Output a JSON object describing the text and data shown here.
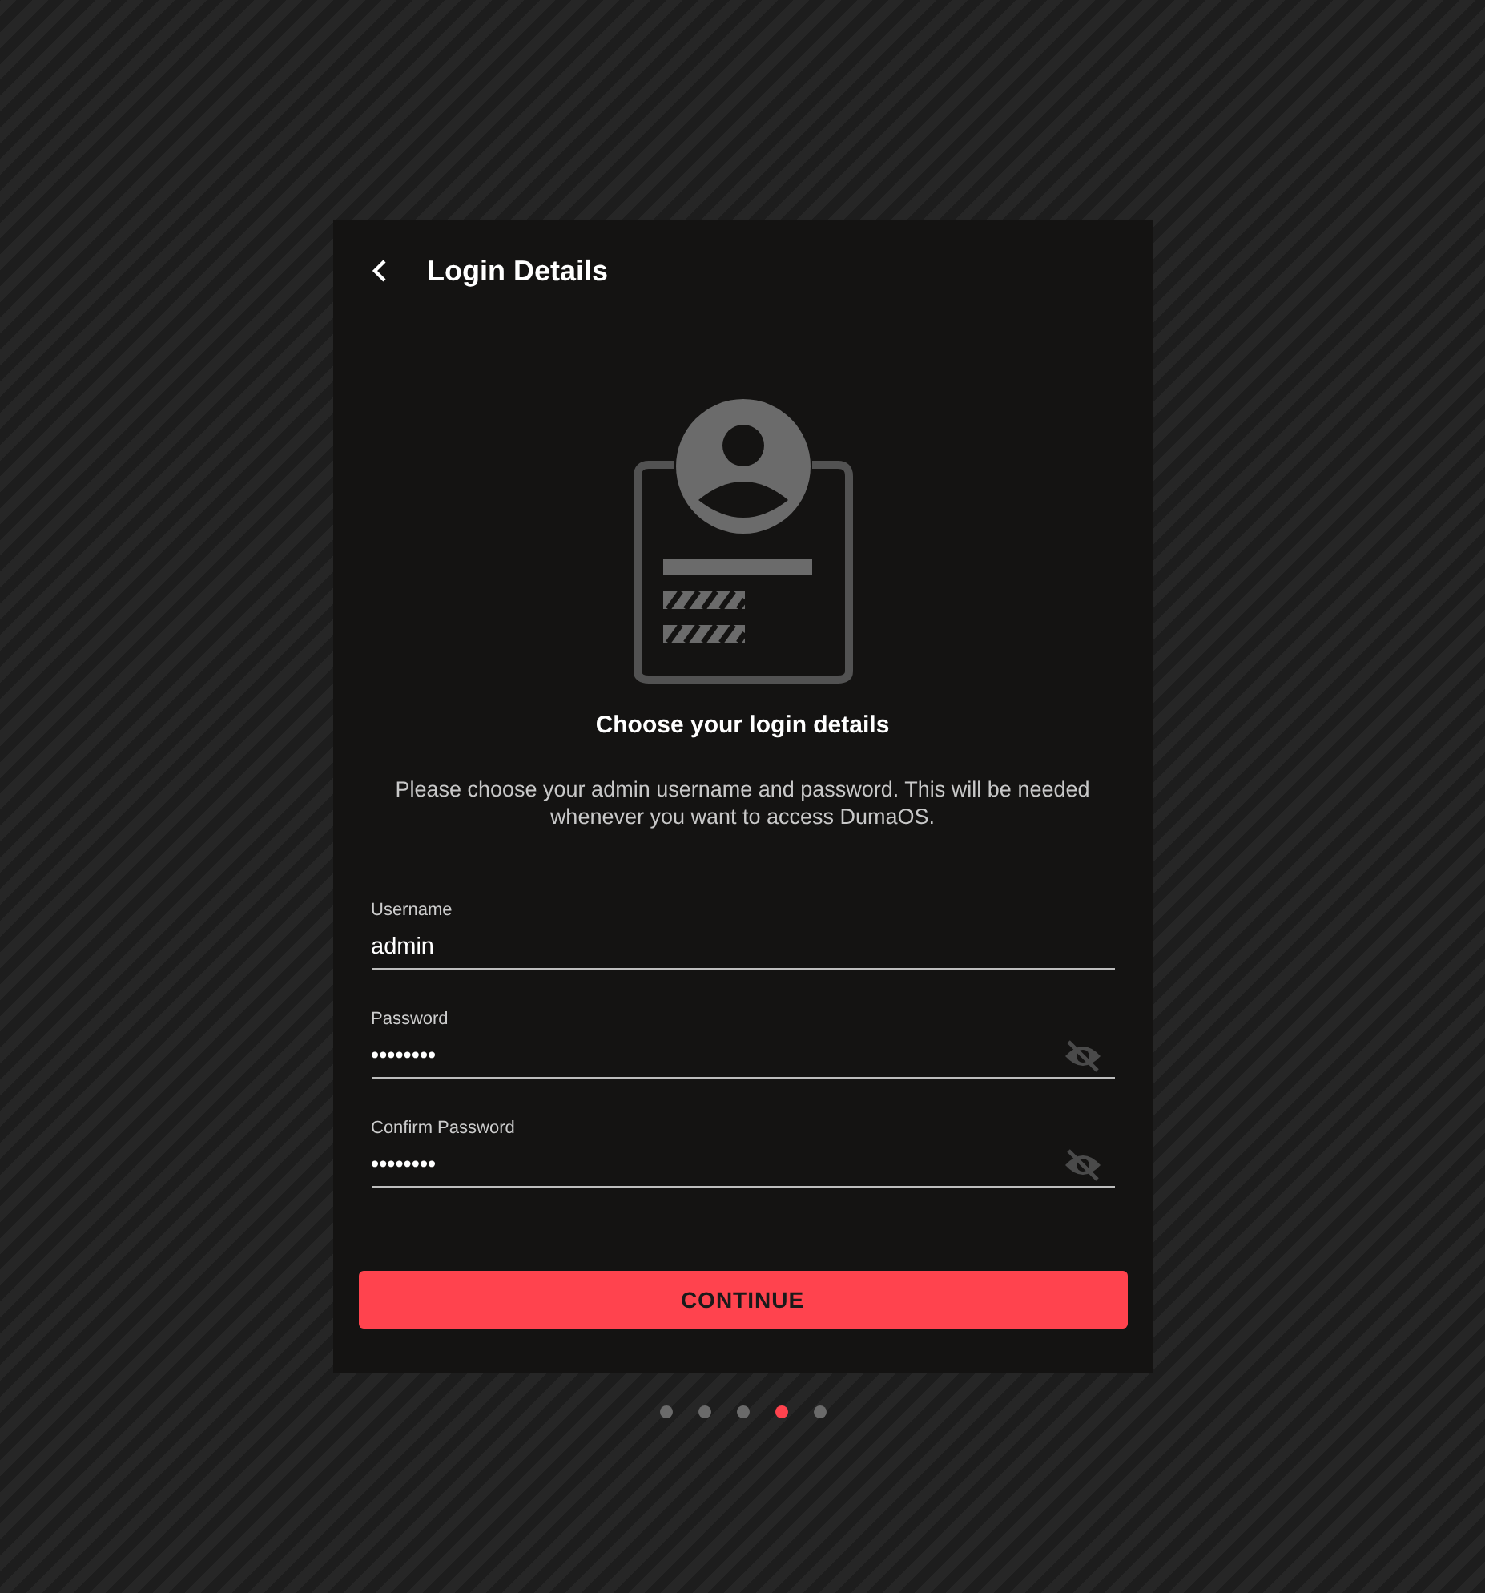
{
  "header": {
    "title": "Login Details"
  },
  "heading": "Choose your login details",
  "description": "Please choose your admin username and password. This will be needed whenever you want to access DumaOS.",
  "fields": [
    {
      "label": "Username",
      "value": "admin",
      "masked": false
    },
    {
      "label": "Password",
      "value": "••••••••",
      "masked": true
    },
    {
      "label": "Confirm Password",
      "value": "••••••••",
      "masked": true
    }
  ],
  "button": "CONTINUE",
  "steps": [
    {
      "selected": false
    },
    {
      "selected": false
    },
    {
      "selected": false
    },
    {
      "selected": true
    },
    {
      "selected": false
    }
  ]
}
